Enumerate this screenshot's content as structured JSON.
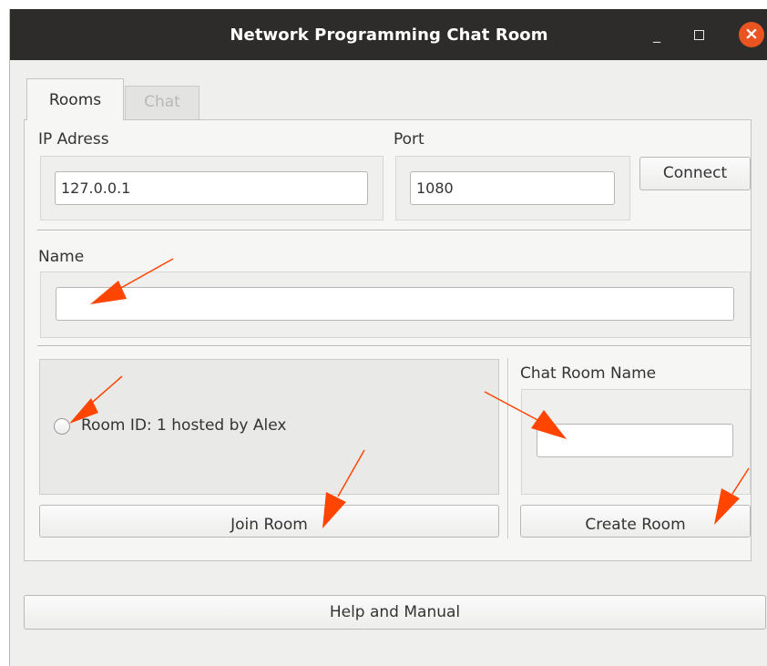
{
  "window": {
    "title": "Network Programming Chat Room",
    "minimize_glyph": "_",
    "close_glyph": "×"
  },
  "tabs": [
    {
      "label": "Rooms",
      "active": true
    },
    {
      "label": "Chat",
      "active": false
    }
  ],
  "connection": {
    "ip_label": "IP Adress",
    "ip_value": "127.0.0.1",
    "port_label": "Port",
    "port_value": "1080",
    "connect_label": "Connect"
  },
  "name_section": {
    "label": "Name",
    "value": ""
  },
  "rooms": {
    "items": [
      {
        "label": "Room ID: 1 hosted by Alex",
        "selected": false
      }
    ],
    "join_label": "Join Room"
  },
  "create": {
    "label": "Chat Room Name",
    "value": "",
    "create_label": "Create Room"
  },
  "help_label": "Help and Manual",
  "colors": {
    "titlebar": "#2d2c2b",
    "close_button": "#e95420",
    "annotation_arrow": "#ff4500",
    "window_bg": "#efefee"
  }
}
